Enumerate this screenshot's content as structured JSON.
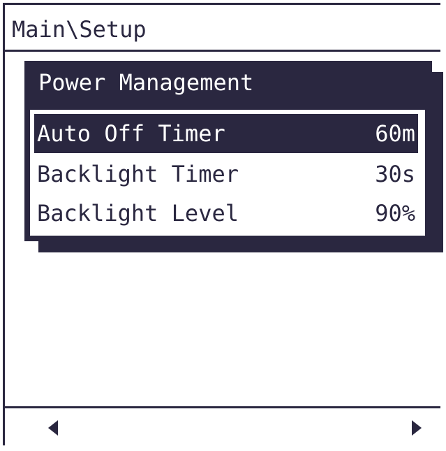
{
  "header": {
    "breadcrumb": "Main\\Setup"
  },
  "panel": {
    "title": "Power Management",
    "items": [
      {
        "label": "Auto Off Timer",
        "value": "60m",
        "selected": true
      },
      {
        "label": "Backlight Timer",
        "value": "30s",
        "selected": false
      },
      {
        "label": "Backlight Level",
        "value": "90%",
        "selected": false
      }
    ]
  },
  "footer": {
    "left_icon": "triangle-left-icon",
    "right_icon": "triangle-right-icon"
  },
  "colors": {
    "foreground": "#2a2740",
    "background": "#ffffff"
  }
}
